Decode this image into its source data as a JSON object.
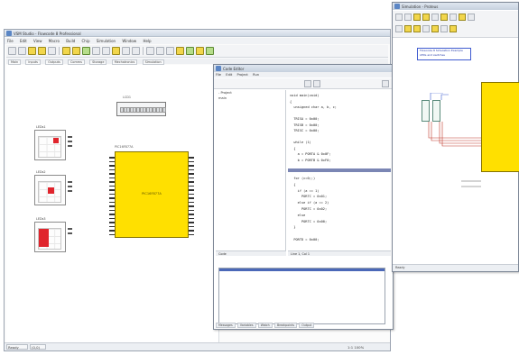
{
  "main_window": {
    "title": "VSM Studio - Flowcode 8 Professional",
    "menu": [
      "File",
      "Edit",
      "View",
      "Macro",
      "Build",
      "Chip",
      "Simulation",
      "Window",
      "Help"
    ],
    "tabs": [
      "Main",
      "Inputs",
      "Outputs",
      "Comms",
      "Storage",
      "Mechatronics",
      "Simulation"
    ],
    "status": {
      "left": "Ready",
      "mid": "(0,0)",
      "right": "1:1 100%"
    }
  },
  "schematic": {
    "lcd": {
      "label": "LCD1",
      "cells": 14
    },
    "components": [
      {
        "label": "LEDs1",
        "led": "top-right"
      },
      {
        "label": "LEDs2",
        "led": "center"
      },
      {
        "label": "LEDs3",
        "led": "bottom-left"
      }
    ],
    "mcu": {
      "label": "PIC16F877A",
      "name": "PIC16F877A"
    }
  },
  "code_window": {
    "title": "Code Editor",
    "menu": [
      "File",
      "Edit",
      "Project",
      "Run"
    ],
    "tree": [
      "- Project",
      "   main"
    ],
    "code_lines_top": [
      "void main(void)",
      "{",
      "  unsigned char a, b, c;",
      "",
      "  TRISA = 0x00;",
      "  TRISB = 0x00;",
      "  TRISC = 0x00;",
      "",
      "  while (1)",
      "  {",
      "    a = PORTA & 0x0F;",
      "    b = PORTB & 0xF0;"
    ],
    "code_lines_bottom": [
      "  for (c=0;;)",
      "  {",
      "    if (a == 1)",
      "      PORTC = 0x01;",
      "    else if (a == 2)",
      "      PORTC = 0x02;",
      "    else",
      "      PORTC = 0x00;",
      "  }",
      "",
      "  PORTD = 0x00;"
    ],
    "left_footer": "Code",
    "status": "Line 1, Col 1",
    "bottom_tabs": [
      "Messages",
      "Variables",
      "Watch",
      "Breakpoints",
      "Output"
    ]
  },
  "right_window": {
    "title": "Simulation - Proteus",
    "note_lines": [
      "Flowcode 8 Simulation Example",
      "LEDs and switches"
    ],
    "status": "Ready"
  },
  "colors": {
    "chip_yellow": "#ffe000",
    "led_red": "#e0242c",
    "selection_blue": "#4b68b8"
  }
}
